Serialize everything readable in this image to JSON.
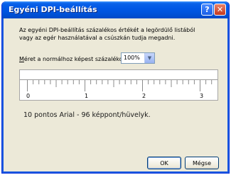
{
  "window": {
    "title": "Egyéni DPI-beállítás",
    "help_label": "?",
    "close_label": "✕"
  },
  "description": {
    "line1": "Az egyéni DPI-beállítás százalékos értékét a legördülő listából",
    "line2": "vagy az egér használatával a csúszkán tudja megadni."
  },
  "scale": {
    "label_prefix": "M",
    "label_rest": "éret a normálhoz képest százalékosan:",
    "selected_value": "100%",
    "dropdown_glyph": "▼"
  },
  "ruler": {
    "labels": [
      "0",
      "1",
      "2",
      "3"
    ]
  },
  "sample_text": "10 pontos Arial - 96 képpont/hüvelyk.",
  "buttons": {
    "ok": "OK",
    "cancel": "Mégse"
  },
  "colors": {
    "titlebar": "#0058e6",
    "dialog_background": "#ece9d8",
    "close_button": "#c5391f"
  }
}
